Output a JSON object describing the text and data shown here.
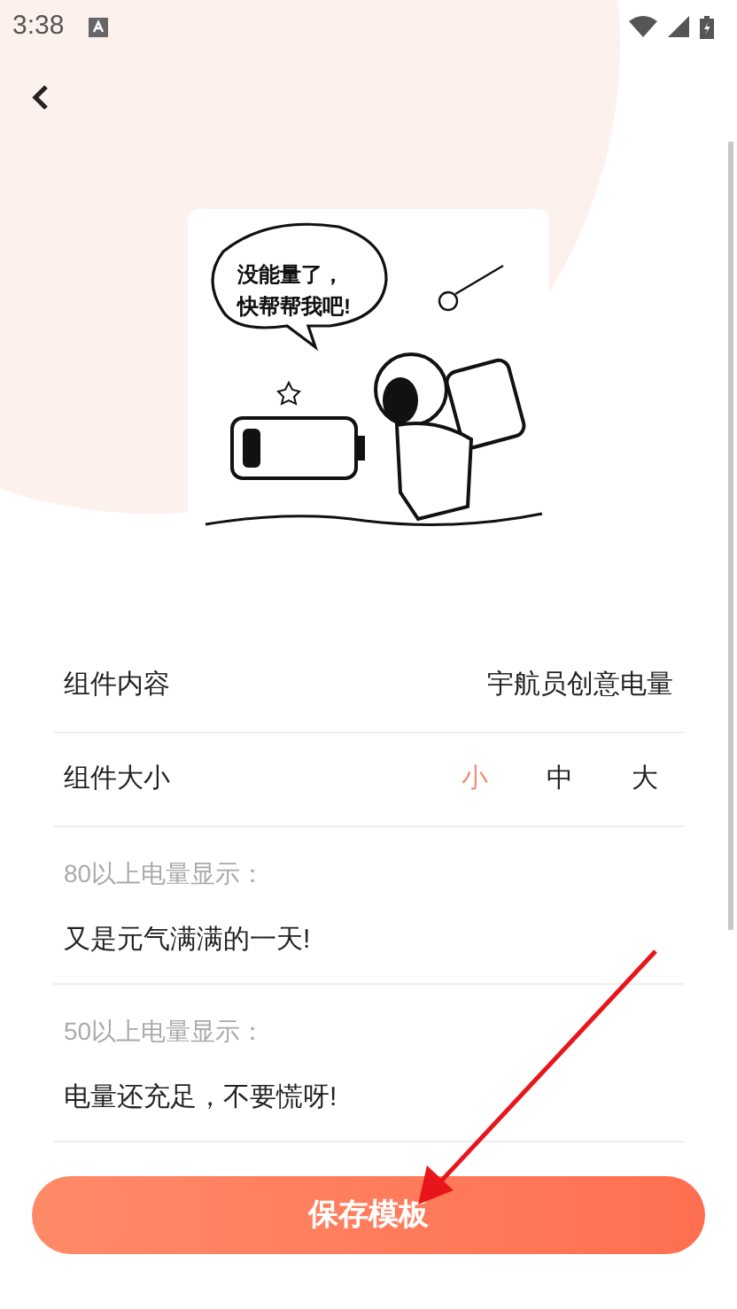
{
  "status_bar": {
    "time": "3:38"
  },
  "illustration": {
    "bubble_lines": [
      "没能量了，",
      "快帮帮我吧!"
    ]
  },
  "content_row": {
    "label": "组件内容",
    "value": "宇航员创意电量"
  },
  "size_row": {
    "label": "组件大小",
    "options": [
      {
        "label": "小",
        "selected": true
      },
      {
        "label": "中",
        "selected": false
      },
      {
        "label": "大",
        "selected": false
      }
    ]
  },
  "messages": [
    {
      "label": "80以上电量显示：",
      "value": "又是元气满满的一天!"
    },
    {
      "label": "50以上电量显示：",
      "value": "电量还充足，不要慌呀!"
    }
  ],
  "save_button": {
    "label": "保存模板"
  }
}
